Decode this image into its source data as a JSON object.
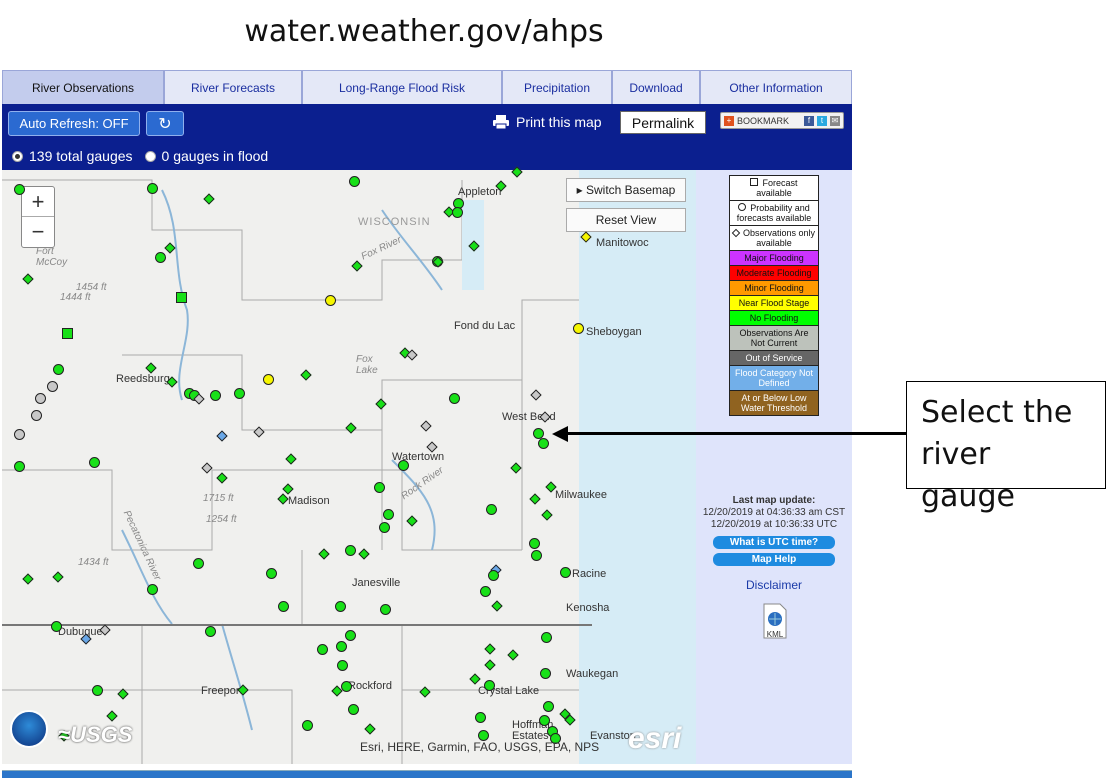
{
  "page": {
    "url_title": "water.weather.gov/ahps"
  },
  "tabs": [
    {
      "label": "River Observations",
      "active": true
    },
    {
      "label": "River Forecasts",
      "active": false
    },
    {
      "label": "Long-Range Flood Risk",
      "active": false
    },
    {
      "label": "Precipitation",
      "active": false
    },
    {
      "label": "Download",
      "active": false
    },
    {
      "label": "Other Information",
      "active": false
    }
  ],
  "toolbar": {
    "auto_refresh": "Auto Refresh: OFF",
    "reload_icon": "↻",
    "print_label": "Print this map",
    "permalink": "Permalink",
    "bookmark": "BOOKMARK"
  },
  "gauge_filter": {
    "total": "139 total gauges",
    "in_flood": "0 gauges in flood",
    "selected": "total"
  },
  "map": {
    "zoom_in": "+",
    "zoom_out": "−",
    "switch_basemap": "▸ Switch Basemap",
    "reset_view": "Reset View",
    "labels": {
      "appleton": "Appleton",
      "wisconsin": "WISCONSIN",
      "manitowoc": "Manitowoc",
      "fort_mccoy": "Fort McCoy",
      "elev_1454": "1454 ft",
      "elev_1444": "1444 ft",
      "fox_river": "Fox River",
      "fond_du_lac": "Fond du Lac",
      "sheboygan": "Sheboygan",
      "reedsburg": "Reedsburg",
      "fox_lake": "Fox Lake",
      "west_bend": "West Bend",
      "watertown": "Watertown",
      "rock_river": "Rock River",
      "elev_1715": "1715 ft",
      "madison": "Madison",
      "milwaukee": "Milwaukee",
      "elev_1254": "1254 ft",
      "pecatonica": "Pecatonica River",
      "elev_1434": "1434 ft",
      "janesville": "Janesville",
      "racine": "Racine",
      "kenosha": "Kenosha",
      "dubuque": "Dubuque",
      "waukegan": "Waukegan",
      "freeport": "Freeport",
      "rockford": "Rockford",
      "crystal_lake": "Crystal Lake",
      "hoffman_estates": "Hoffman Estates",
      "evanston": "Evanston"
    },
    "attribution": "Esri, HERE, Garmin, FAO, USGS, EPA, NPS",
    "esri": "esri",
    "usgs": "≈USGS"
  },
  "legend": [
    {
      "label": "Forecast available",
      "color": "#ffffff"
    },
    {
      "label": "Probability and forecasts available",
      "color": "#ffffff"
    },
    {
      "label": "Observations only available",
      "color": "#ffffff"
    },
    {
      "label": "Major Flooding",
      "color": "#cc33ff"
    },
    {
      "label": "Moderate Flooding",
      "color": "#ff0000"
    },
    {
      "label": "Minor Flooding",
      "color": "#ff9900"
    },
    {
      "label": "Near Flood Stage",
      "color": "#ffff00"
    },
    {
      "label": "No Flooding",
      "color": "#00ff00"
    },
    {
      "label": "Observations Are Not Current",
      "color": "#bdc2bb"
    },
    {
      "label": "Out of Service",
      "color": "#666666"
    },
    {
      "label": "Flood Category Not Defined",
      "color": "#72afe9"
    },
    {
      "label": "At or Below Low Water Threshold",
      "color": "#906320"
    }
  ],
  "sidebar": {
    "last_update_title": "Last map update:",
    "last_update_cst": "12/20/2019 at 04:36:33 am CST",
    "last_update_utc": "12/20/2019 at 10:36:33 UTC",
    "utc_button": "What is UTC time?",
    "help_button": "Map Help",
    "disclaimer": "Disclaimer",
    "kml": "KML"
  },
  "annotation": {
    "callout": "Select the river gauge"
  }
}
